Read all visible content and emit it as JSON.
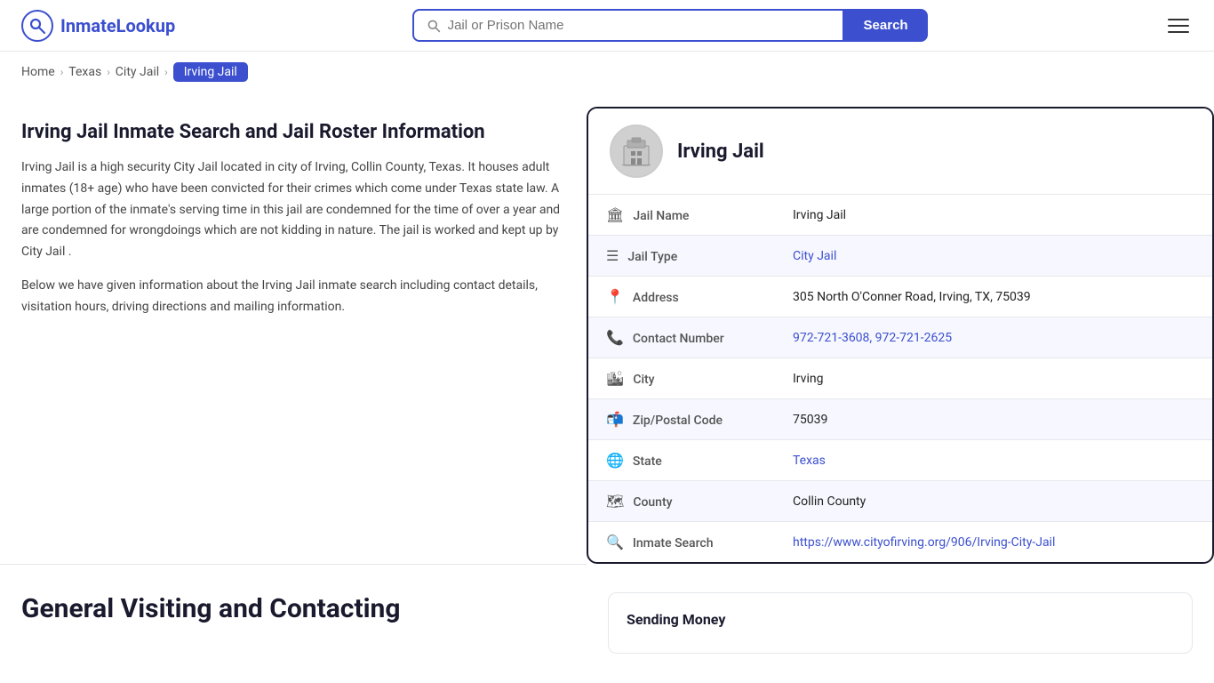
{
  "logo": {
    "icon": "Q",
    "text_before": "Inmate",
    "text_after": "Lookup"
  },
  "search": {
    "placeholder": "Jail or Prison Name",
    "button_label": "Search"
  },
  "breadcrumb": {
    "items": [
      {
        "label": "Home",
        "href": "#"
      },
      {
        "label": "Texas",
        "href": "#"
      },
      {
        "label": "City Jail",
        "href": "#"
      },
      {
        "label": "Irving Jail",
        "active": true
      }
    ]
  },
  "page": {
    "title": "Irving Jail Inmate Search and Jail Roster Information",
    "desc1": "Irving Jail is a high security City Jail located in city of Irving, Collin County, Texas. It houses adult inmates (18+ age) who have been convicted for their crimes which come under Texas state law. A large portion of the inmate's serving time in this jail are condemned for the time of over a year and are condemned for wrongdoings which are not kidding in nature. The jail is worked and kept up by City Jail .",
    "desc2": "Below we have given information about the Irving Jail inmate search including contact details, visitation hours, driving directions and mailing information."
  },
  "card": {
    "title": "Irving Jail",
    "fields": [
      {
        "icon": "🏛",
        "label": "Jail Name",
        "value": "Irving Jail",
        "link": null
      },
      {
        "icon": "☰",
        "label": "Jail Type",
        "value": "City Jail",
        "link": "#"
      },
      {
        "icon": "📍",
        "label": "Address",
        "value": "305 North O'Conner Road, Irving, TX, 75039",
        "link": null
      },
      {
        "icon": "📞",
        "label": "Contact Number",
        "value": "972-721-3608, 972-721-2625",
        "link": "#"
      },
      {
        "icon": "🏙",
        "label": "City",
        "value": "Irving",
        "link": null
      },
      {
        "icon": "📬",
        "label": "Zip/Postal Code",
        "value": "75039",
        "link": null
      },
      {
        "icon": "🌐",
        "label": "State",
        "value": "Texas",
        "link": "#"
      },
      {
        "icon": "🗺",
        "label": "County",
        "value": "Collin County",
        "link": null
      },
      {
        "icon": "🔍",
        "label": "Inmate Search",
        "value": "https://www.cityofirving.org/906/Irving-City-Jail",
        "link": "https://www.cityofirving.org/906/Irving-City-Jail"
      }
    ]
  },
  "bottom": {
    "title": "General Visiting and Contacting",
    "sending_money_title": "Sending Money"
  }
}
